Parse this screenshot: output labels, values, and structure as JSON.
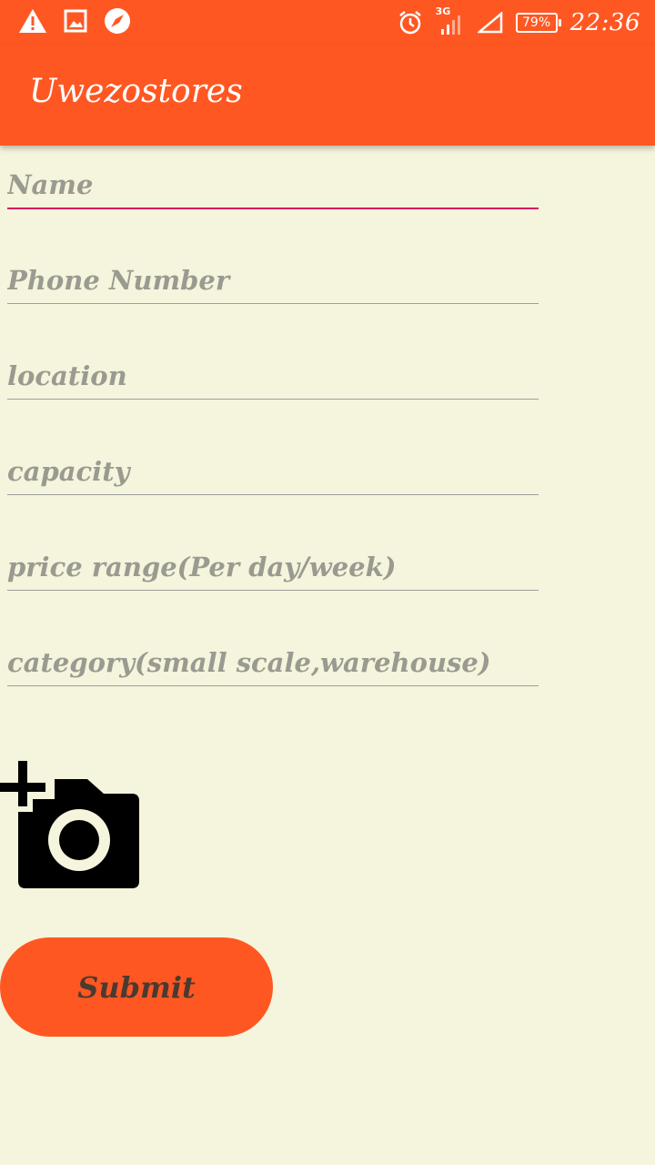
{
  "status_bar": {
    "time": "22:36",
    "battery": "79%",
    "network": "3G",
    "left_icons": [
      "warning-icon",
      "image-icon",
      "compass-icon"
    ],
    "right_icons": [
      "alarm-icon",
      "signal-icon",
      "signal-empty-icon",
      "battery-icon"
    ]
  },
  "app_bar": {
    "title": "Uwezostores"
  },
  "form": {
    "name_placeholder": "Name",
    "phone_placeholder": "Phone Number",
    "location_placeholder": "location",
    "capacity_placeholder": "capacity",
    "price_placeholder": "price range(Per day/week)",
    "category_placeholder": "category(small scale,warehouse)"
  },
  "camera": {
    "icon": "add-photo-icon"
  },
  "submit": {
    "label": "Submit"
  },
  "colors": {
    "accent": "#ff5722",
    "background": "#f5f4dc",
    "active_underline": "#d81b60"
  }
}
